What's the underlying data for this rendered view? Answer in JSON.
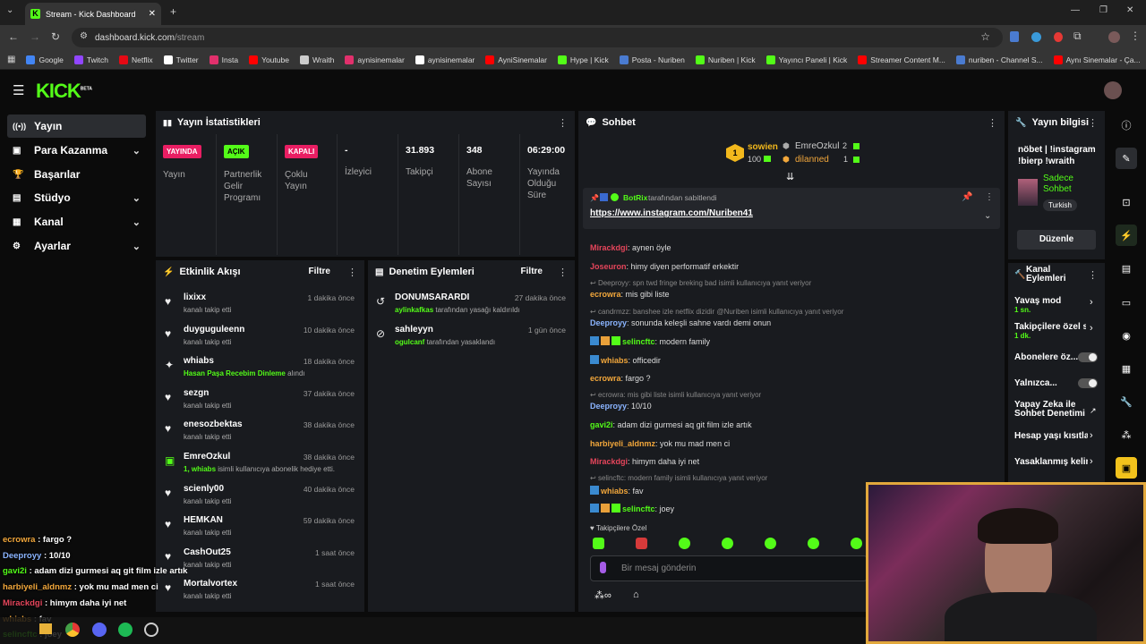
{
  "browser": {
    "tab_title": "Stream - Kick Dashboard",
    "url_host": "dashboard.kick.com",
    "url_path": "/stream",
    "bookmarks": [
      {
        "label": "Google",
        "color": "#4285f4"
      },
      {
        "label": "Twitch",
        "color": "#9146ff"
      },
      {
        "label": "Netflix",
        "color": "#e50914"
      },
      {
        "label": "Twitter",
        "color": "#ffffff"
      },
      {
        "label": "Insta",
        "color": "#e1306c"
      },
      {
        "label": "Youtube",
        "color": "#ff0000"
      },
      {
        "label": "Wraith",
        "color": "#cccccc"
      },
      {
        "label": "aynisinemalar",
        "color": "#e1306c"
      },
      {
        "label": "aynisinemalar",
        "color": "#ffffff"
      },
      {
        "label": "AyniSinemalar",
        "color": "#ff0000"
      },
      {
        "label": "Hype | Kick",
        "color": "#53fc18"
      },
      {
        "label": "Posta - Nuriben",
        "color": "#4a7bd0"
      },
      {
        "label": "Nuriben | Kick",
        "color": "#53fc18"
      },
      {
        "label": "Yayıncı Paneli | Kick",
        "color": "#53fc18"
      },
      {
        "label": "Streamer Content M...",
        "color": "#ff0000"
      },
      {
        "label": "nuriben - Channel S...",
        "color": "#4a7bd0"
      },
      {
        "label": "Aynı Sinemalar - Ça...",
        "color": "#ff0000"
      }
    ]
  },
  "sidebar": {
    "items": [
      {
        "label": "Yayın",
        "icon": "broadcast-icon",
        "active": true
      },
      {
        "label": "Para Kazanma",
        "icon": "money-icon",
        "chevron": true
      },
      {
        "label": "Başarılar",
        "icon": "trophy-icon"
      },
      {
        "label": "Stüdyo",
        "icon": "studio-icon",
        "chevron": true
      },
      {
        "label": "Kanal",
        "icon": "channel-icon",
        "chevron": true
      },
      {
        "label": "Ayarlar",
        "icon": "gear-icon",
        "chevron": true
      }
    ]
  },
  "stats": {
    "title": "Yayın İstatistikleri",
    "cells": [
      {
        "badge": "YAYINDA",
        "badge_color": "#e91e63",
        "label": "Yayın"
      },
      {
        "badge": "AÇIK",
        "badge_color": "#53fc18",
        "label": "Partnerlik Gelir Programı"
      },
      {
        "badge": "KAPALI",
        "badge_color": "#e91e63",
        "label": "Çoklu Yayın"
      },
      {
        "value": "-",
        "label": "İzleyici"
      },
      {
        "value": "31.893",
        "label": "Takipçi"
      },
      {
        "value": "348",
        "label": "Abone Sayısı"
      },
      {
        "value": "06:29:00",
        "label": "Yayında Olduğu Süre"
      }
    ]
  },
  "events": {
    "title": "Etkinlik Akışı",
    "filter": "Filtre",
    "items": [
      {
        "name": "lixixx",
        "time": "1 dakika önce",
        "sub": "kanalı takip etti",
        "icon": "heart-icon"
      },
      {
        "name": "duyguguleenn",
        "time": "10 dakika önce",
        "sub": "kanalı takip etti",
        "icon": "heart-icon"
      },
      {
        "name": "whiabs",
        "time": "18 dakika önce",
        "sub_hl": "Hasan Paşa Recebim Dinleme",
        "sub": " alındı",
        "icon": "reward-icon"
      },
      {
        "name": "sezgn",
        "time": "37 dakika önce",
        "sub": "kanalı takip etti",
        "icon": "heart-icon"
      },
      {
        "name": "enesozbektas",
        "time": "38 dakika önce",
        "sub": "kanalı takip etti",
        "icon": "heart-icon"
      },
      {
        "name": "EmreOzkul",
        "time": "38 dakika önce",
        "sub_hl": "1, whiabs",
        "sub": " isimli kullanıcıya abonelik hediye etti.",
        "icon": "gift-icon"
      },
      {
        "name": "scienly00",
        "time": "40 dakika önce",
        "sub": "kanalı takip etti",
        "icon": "heart-icon"
      },
      {
        "name": "HEMKAN",
        "time": "59 dakika önce",
        "sub": "kanalı takip etti",
        "icon": "heart-icon"
      },
      {
        "name": "CashOut25",
        "time": "1 saat önce",
        "sub": "kanalı takip etti",
        "icon": "heart-icon"
      },
      {
        "name": "Mortalvortex",
        "time": "1 saat önce",
        "sub": "kanalı takip etti",
        "icon": "heart-icon"
      }
    ]
  },
  "moderation": {
    "title": "Denetim Eylemleri",
    "filter": "Filtre",
    "items": [
      {
        "name": "DONUMSARARDI",
        "time": "27 dakika önce",
        "actor": "aylinkafkas",
        "action": " tarafından yasağı kaldırıldı",
        "icon": "undo-icon"
      },
      {
        "name": "sahleyyn",
        "time": "1 gün önce",
        "actor": "ogulcanf",
        "action": " tarafından yasaklandı",
        "icon": "ban-icon"
      }
    ]
  },
  "chat": {
    "title": "Sohbet",
    "top_gifter": {
      "name": "sowien",
      "count": "100",
      "rank": "1"
    },
    "gifters": [
      {
        "name": "EmreOzkul",
        "count": "2"
      },
      {
        "name": "dilanned",
        "count": "1"
      }
    ],
    "pinned": {
      "by": "BotRix",
      "by_suffix": " tarafından sabitlendi",
      "link": "https://www.instagram.com/Nuriben41"
    },
    "messages": [
      {
        "user": "Mirackdgi",
        "color": "#e5455b",
        "text": "aynen öyle"
      },
      {
        "user": "Joseuron",
        "color": "#e5455b",
        "text": "himy diyen performatif erkektir"
      },
      {
        "reply": "Deeproyy: spn twd fringe breking bad isimli kullanıcıya yanıt veriyor"
      },
      {
        "user": "ecrowra",
        "color": "#f2a73b",
        "text": "mis gibi liste"
      },
      {
        "reply": "candrmzz: banshee izle netflix dizidir @Nuriben isimli kullanıcıya yanıt veriyor"
      },
      {
        "user": "Deeproyy",
        "color": "#8ab4ff",
        "text": "sonunda keleşli sahne vardı demi onun"
      },
      {
        "user": "selincftc",
        "color": "#53fc18",
        "text": "modern family"
      },
      {
        "user": "whiabs",
        "color": "#f2a73b",
        "text": "officedir"
      },
      {
        "user": "ecrowra",
        "color": "#f2a73b",
        "text": "fargo ?"
      },
      {
        "reply": "ecrowra: mis gibi liste isimli kullanıcıya yanıt veriyor"
      },
      {
        "user": "Deeproyy",
        "color": "#8ab4ff",
        "text": "10/10"
      },
      {
        "user": "gavi2i",
        "color": "#53fc18",
        "text": "adam dizi gurmesi aq git film izle artık"
      },
      {
        "user": "harbiyeli_aldnmz",
        "color": "#f2a73b",
        "text": "yok mu mad men ci"
      },
      {
        "user": "Mirackdgi",
        "color": "#e5455b",
        "text": "himym daha iyi net"
      },
      {
        "reply": "selincftc: modern family isimli kullanıcıya yanıt veriyor"
      },
      {
        "user": "whiabs",
        "color": "#f2a73b",
        "text": "fav"
      },
      {
        "user": "selincftc",
        "color": "#53fc18",
        "text": "joey"
      }
    ],
    "followers_only": "Takipçilere Özel",
    "input_placeholder": "Bir mesaj gönderin"
  },
  "stream_info": {
    "title": "Yayın bilgisi",
    "stream_title": "nöbet | !instagram !bierp !wraith",
    "category": "Sadece Sohbet",
    "tag": "Turkish",
    "edit": "Düzenle"
  },
  "channel_actions": {
    "title": "Kanal Eylemleri",
    "items": [
      {
        "label": "Yavaş mod",
        "sub": "1 sn.",
        "kind": "chevron"
      },
      {
        "label": "Takipçilere özel s",
        "sub": "1 dk.",
        "kind": "chevron"
      },
      {
        "label": "Abonelere öz...",
        "kind": "toggle"
      },
      {
        "label": "Yalnızca...",
        "kind": "toggle"
      },
      {
        "label": "Yapay Zeka ile Sohbet Denetimi",
        "kind": "external"
      },
      {
        "label": "Hesap yaşı kısıtla",
        "kind": "chevron"
      },
      {
        "label": "Yasaklanmış kelin",
        "kind": "chevron"
      }
    ]
  },
  "overlay_chat": [
    {
      "user": "ecrowra",
      "color": "#f2a73b",
      "text": " : fargo ?"
    },
    {
      "user": "Deeproyy",
      "color": "#8ab4ff",
      "text": " : 10/10"
    },
    {
      "user": "gavi2i",
      "color": "#53fc18",
      "text": " : adam dizi gurmesi aq git film izle artık"
    },
    {
      "user": "harbiyeli_aldnmz",
      "color": "#f2a73b",
      "text": " : yok mu mad men ci"
    },
    {
      "user": "Mirackdgi",
      "color": "#e5455b",
      "text": " : himym daha iyi net"
    },
    {
      "user": "whiabs",
      "color": "#f2a73b",
      "text": " : fav"
    },
    {
      "user": "selincftc",
      "color": "#53fc18",
      "text": " : joey"
    }
  ],
  "colors": {
    "accent": "#53fc18",
    "panel": "#191b1f",
    "bg": "#0b0b0b"
  }
}
